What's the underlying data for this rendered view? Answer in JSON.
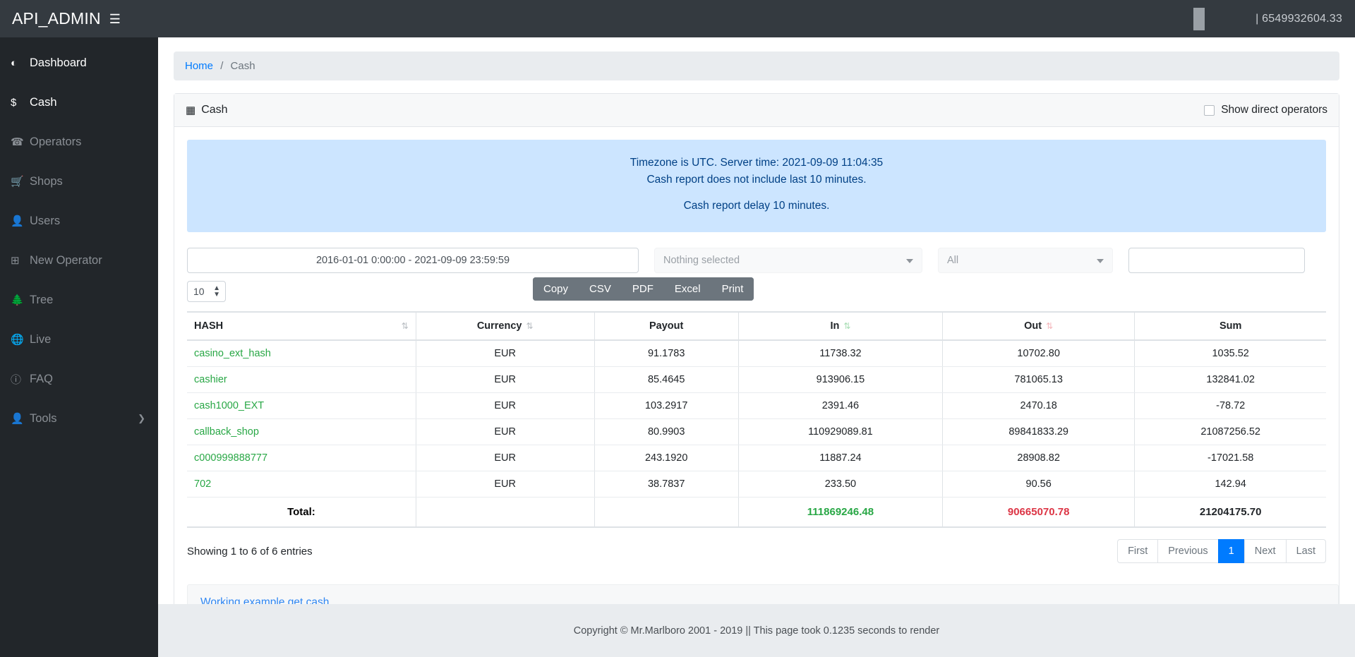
{
  "navbar": {
    "brand": "API_ADMIN",
    "burger_icon": "hamburger-icon",
    "balance": "| 6549932604.33"
  },
  "sidebar": {
    "items": [
      {
        "label": "Dashboard",
        "icon": "tachometer-icon",
        "active": true,
        "caret": false
      },
      {
        "label": "Cash",
        "icon": "dollar-icon",
        "active": true,
        "caret": false
      },
      {
        "label": "Operators",
        "icon": "headset-icon",
        "active": false,
        "caret": false
      },
      {
        "label": "Shops",
        "icon": "cart-icon",
        "active": false,
        "caret": false
      },
      {
        "label": "Users",
        "icon": "user-icon",
        "active": false,
        "caret": false
      },
      {
        "label": "New Operator",
        "icon": "plus-square-icon",
        "active": false,
        "caret": false
      },
      {
        "label": "Tree",
        "icon": "tree-icon",
        "active": false,
        "caret": false
      },
      {
        "label": "Live",
        "icon": "globe-icon",
        "active": false,
        "caret": false
      },
      {
        "label": "FAQ",
        "icon": "question-icon",
        "active": false,
        "caret": false
      },
      {
        "label": "Tools",
        "icon": "user-icon",
        "active": false,
        "caret": true
      }
    ]
  },
  "breadcrumb": {
    "home": "Home",
    "separator": "/",
    "current": "Cash"
  },
  "card": {
    "title": "Cash",
    "title_icon": "table-grid-icon",
    "checkbox_label": "Show direct operators",
    "checkbox_checked": false
  },
  "alert": {
    "line1": "Timezone is UTC. Server time: 2021-09-09 11:04:35",
    "line2": "Cash report does not include last 10 minutes.",
    "line3": "Cash report delay 10 minutes."
  },
  "filters": {
    "date_range": "2016-01-01 0:00:00 - 2021-09-09 23:59:59",
    "operator_select": "Nothing selected",
    "type_select": "All",
    "search_value": "",
    "search_placeholder": "",
    "page_length": "10"
  },
  "export_buttons": [
    "Copy",
    "CSV",
    "PDF",
    "Excel",
    "Print"
  ],
  "table": {
    "columns": [
      "HASH",
      "Currency",
      "Payout",
      "In",
      "Out",
      "Sum"
    ],
    "rows": [
      {
        "hash": "casino_ext_hash",
        "currency": "EUR",
        "payout": "91.1783",
        "in": "11738.32",
        "out": "10702.80",
        "sum": "1035.52"
      },
      {
        "hash": "cashier",
        "currency": "EUR",
        "payout": "85.4645",
        "in": "913906.15",
        "out": "781065.13",
        "sum": "132841.02"
      },
      {
        "hash": "cash1000_EXT",
        "currency": "EUR",
        "payout": "103.2917",
        "in": "2391.46",
        "out": "2470.18",
        "sum": "-78.72"
      },
      {
        "hash": "callback_shop",
        "currency": "EUR",
        "payout": "80.9903",
        "in": "110929089.81",
        "out": "89841833.29",
        "sum": "21087256.52"
      },
      {
        "hash": "c000999888777",
        "currency": "EUR",
        "payout": "243.1920",
        "in": "11887.24",
        "out": "28908.82",
        "sum": "-17021.58"
      },
      {
        "hash": "702",
        "currency": "EUR",
        "payout": "38.7837",
        "in": "233.50",
        "out": "90.56",
        "sum": "142.94"
      }
    ],
    "total": {
      "label": "Total:",
      "in": "111869246.48",
      "out": "90665070.78",
      "sum": "21204175.70"
    }
  },
  "pagination": {
    "entries_info": "Showing 1 to 6 of 6 entries",
    "buttons": [
      "First",
      "Previous",
      "1",
      "Next",
      "Last"
    ],
    "active": "1"
  },
  "example": {
    "link": "Working example get cash"
  },
  "footer": {
    "text": "Copyright © Mr.Marlboro 2001 - 2019 || This page took 0.1235 seconds to render"
  },
  "colors": {
    "navbar_bg": "#343a40",
    "sidebar_bg": "#22262a",
    "accent": "#007bff",
    "in_green": "#28a745",
    "out_red": "#dc3545",
    "alert_bg": "#cce5ff",
    "alert_text": "#004085",
    "export_bg": "#6c757d"
  }
}
